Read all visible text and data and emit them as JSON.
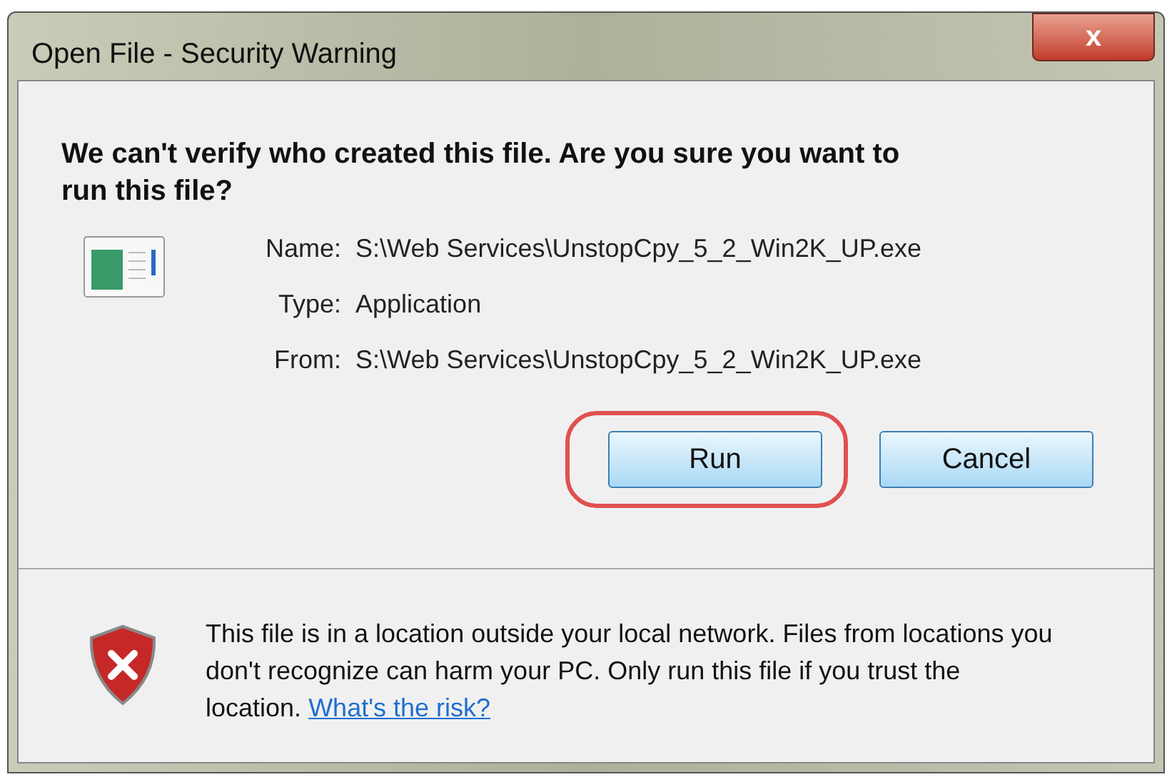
{
  "window": {
    "title": "Open File - Security Warning",
    "close_label": "x"
  },
  "heading": "We can't verify who created this file. Are you sure you want to run this file?",
  "details": [
    {
      "label": "Name:",
      "value": "S:\\Web Services\\UnstopCpy_5_2_Win2K_UP.exe"
    },
    {
      "label": "Type:",
      "value": "Application"
    },
    {
      "label": "From:",
      "value": "S:\\Web Services\\UnstopCpy_5_2_Win2K_UP.exe"
    }
  ],
  "buttons": [
    {
      "label": "Run",
      "highlighted": true
    },
    {
      "label": "Cancel",
      "highlighted": false
    }
  ],
  "warning": {
    "text": "This file is in a location outside your local network. Files from locations you don't recognize can harm your PC. Only run this file if you trust the location.",
    "link": "What's the risk?"
  }
}
